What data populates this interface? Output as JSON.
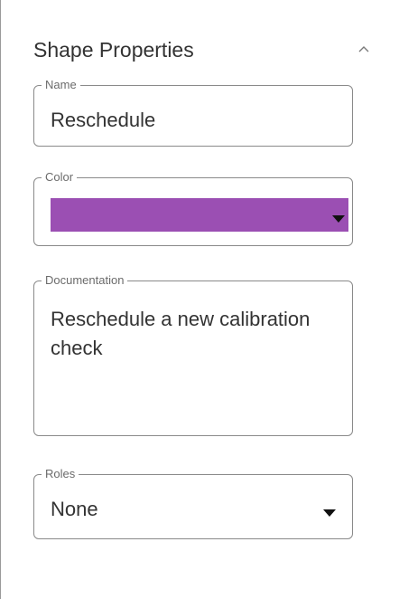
{
  "panel": {
    "title": "Shape Properties",
    "collapse_icon": "chevron-up-icon"
  },
  "fields": {
    "name": {
      "label": "Name",
      "value": "Reschedule"
    },
    "color": {
      "label": "Color",
      "value": "#9b4fb3",
      "dropdown_icon": "caret-down-icon"
    },
    "documentation": {
      "label": "Documentation",
      "value": "Reschedule a new calibration check"
    },
    "roles": {
      "label": "Roles",
      "value": "None",
      "dropdown_icon": "caret-down-icon"
    }
  }
}
